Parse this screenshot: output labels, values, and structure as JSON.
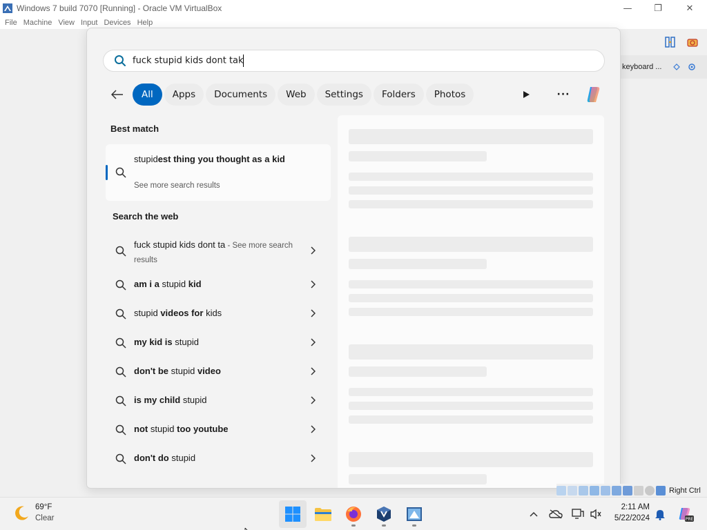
{
  "host_window": {
    "title": "Windows 7 build 7070 [Running] - Oracle VM VirtualBox",
    "menu": [
      "File",
      "Machine",
      "View",
      "Input",
      "Devices",
      "Help"
    ],
    "controls": {
      "minimize": "—",
      "maximize": "❐",
      "close": "✕"
    }
  },
  "guest_side_panel": {
    "text": "keyboard ..."
  },
  "search": {
    "query": "fuck stupid kids dont tak",
    "filters": [
      "All",
      "Apps",
      "Documents",
      "Web",
      "Settings",
      "Folders",
      "Photos"
    ],
    "active_filter": "All",
    "more_label": "···"
  },
  "best_match": {
    "heading": "Best match",
    "title_prefix": "stupid",
    "title_rest": "est thing you thought as a kid",
    "subtitle": "See more search results"
  },
  "web_section": {
    "heading": "Search the web",
    "first": {
      "query": "fuck stupid kids dont ta",
      "suffix": " - See more search results"
    },
    "items": [
      {
        "parts": [
          {
            "t": "am i a ",
            "b": true
          },
          {
            "t": "stupid ",
            "b": false
          },
          {
            "t": "kid",
            "b": true
          }
        ]
      },
      {
        "parts": [
          {
            "t": "stupid ",
            "b": false
          },
          {
            "t": "videos for ",
            "b": true
          },
          {
            "t": "kids",
            "b": false
          }
        ]
      },
      {
        "parts": [
          {
            "t": "my kid is ",
            "b": true
          },
          {
            "t": "stupid",
            "b": false
          }
        ]
      },
      {
        "parts": [
          {
            "t": "don't be ",
            "b": true
          },
          {
            "t": "stupid ",
            "b": false
          },
          {
            "t": "video",
            "b": true
          }
        ]
      },
      {
        "parts": [
          {
            "t": "is my child ",
            "b": true
          },
          {
            "t": "stupid",
            "b": false
          }
        ]
      },
      {
        "parts": [
          {
            "t": "not ",
            "b": true
          },
          {
            "t": "stupid ",
            "b": false
          },
          {
            "t": "too youtube",
            "b": true
          }
        ]
      },
      {
        "parts": [
          {
            "t": "don't do ",
            "b": true
          },
          {
            "t": "stupid",
            "b": false
          }
        ]
      }
    ]
  },
  "taskbar": {
    "weather_temp": "69°F",
    "weather_condition": "Clear",
    "apps": [
      "start-icon",
      "file-explorer-icon",
      "firefox-icon",
      "virtualbox-icon",
      "vm-window-icon"
    ],
    "clock_time": "2:11 AM",
    "clock_date": "5/22/2024"
  },
  "vb_statusbar": {
    "host_key": "Right Ctrl"
  },
  "colors": {
    "accent": "#0067c0",
    "flyout_bg": "#f3f3f3",
    "skeleton": "#ececec"
  }
}
